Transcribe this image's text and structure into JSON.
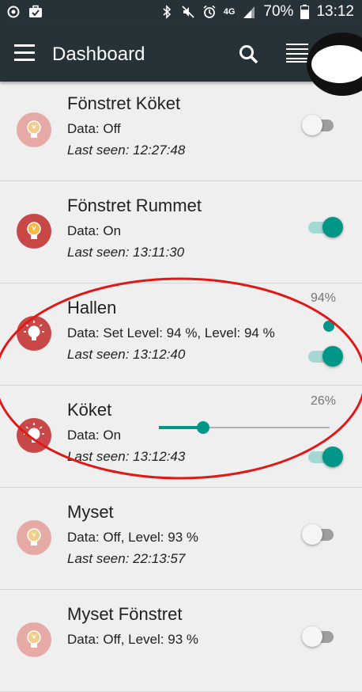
{
  "status_bar": {
    "network": "4G",
    "battery": "70%",
    "time": "13:12"
  },
  "app_bar": {
    "title": "Dashboard"
  },
  "colors": {
    "bar": "#263238",
    "accent": "#009688",
    "bulb_on": "#c84848",
    "bulb_off": "#e6aaa6",
    "annotation": "#e01818"
  },
  "devices": [
    {
      "name": "Fönstret Köket",
      "data": "Data: Off",
      "last_seen": "Last seen: 12:27:48",
      "state": "off"
    },
    {
      "name": "Fönstret Rummet",
      "data": "Data: On",
      "last_seen": "Last seen: 13:11:30",
      "state": "on"
    },
    {
      "name": "Hallen",
      "data": "Data: Set Level: 94 %, Level: 94 %",
      "last_seen": "Last seen: 13:12:40",
      "state": "on",
      "level_label": "94%",
      "level": 94
    },
    {
      "name": "Köket",
      "data": "Data: On",
      "last_seen": "Last seen: 13:12:43",
      "state": "on",
      "level_label": "26%",
      "level": 26
    },
    {
      "name": "Myset",
      "data": "Data: Off, Level: 93 %",
      "last_seen": "Last seen: 22:13:57",
      "state": "off"
    },
    {
      "name": "Myset Fönstret",
      "data": "Data: Off, Level: 93 %",
      "last_seen": "",
      "state": "off"
    }
  ]
}
